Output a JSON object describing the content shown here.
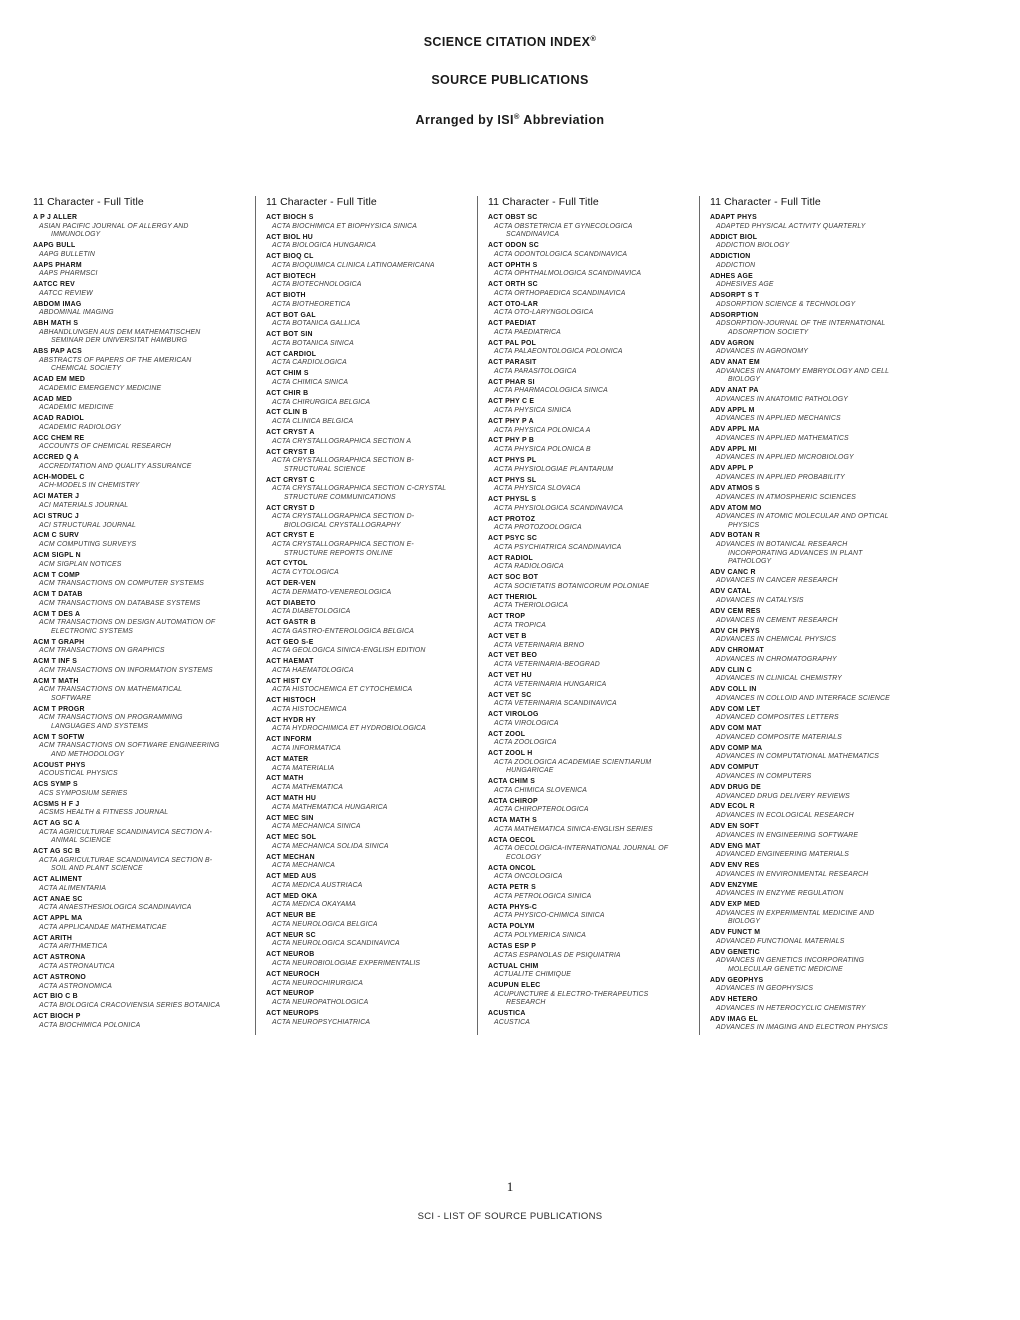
{
  "document": {
    "title_line_1": "SCIENCE CITATION INDEX",
    "title_line_1_sup": "®",
    "title_line_2": "SOURCE PUBLICATIONS",
    "title_line_3_pre": "Arranged by ISI",
    "title_line_3_sup": "®",
    "title_line_3_post": " Abbreviation",
    "page_number": "1",
    "footer_label": "SCI - LIST OF SOURCE PUBLICATIONS",
    "column_header": "11 Character - Full Title"
  },
  "columns": [
    {
      "header": "11 Character - Full Title",
      "entries": [
        {
          "abbrev": "A P J ALLER",
          "full": "ASIAN PACIFIC JOURNAL OF ALLERGY AND",
          "full2": "IMMUNOLOGY"
        },
        {
          "abbrev": "AAPG BULL",
          "full": "AAPG BULLETIN"
        },
        {
          "abbrev": "AAPS PHARM",
          "full": "AAPS PHARMSCI"
        },
        {
          "abbrev": "AATCC REV",
          "full": "AATCC REVIEW"
        },
        {
          "abbrev": "ABDOM IMAG",
          "full": "ABDOMINAL IMAGING"
        },
        {
          "abbrev": "ABH MATH S",
          "full": "ABHANDLUNGEN AUS DEM MATHEMATISCHEN",
          "full2": "SEMINAR DER UNIVERSITAT HAMBURG"
        },
        {
          "abbrev": "ABS PAP ACS",
          "full": "ABSTRACTS OF PAPERS OF THE AMERICAN",
          "full2": "CHEMICAL SOCIETY"
        },
        {
          "abbrev": "ACAD EM MED",
          "full": "ACADEMIC EMERGENCY MEDICINE"
        },
        {
          "abbrev": "ACAD MED",
          "full": "ACADEMIC MEDICINE"
        },
        {
          "abbrev": "ACAD RADIOL",
          "full": "ACADEMIC RADIOLOGY"
        },
        {
          "abbrev": "ACC CHEM RE",
          "full": "ACCOUNTS OF CHEMICAL RESEARCH"
        },
        {
          "abbrev": "ACCRED Q A",
          "full": "ACCREDITATION AND QUALITY ASSURANCE"
        },
        {
          "abbrev": "ACH-MODEL C",
          "full": "ACH-MODELS IN CHEMISTRY"
        },
        {
          "abbrev": "ACI MATER J",
          "full": "ACI MATERIALS JOURNAL"
        },
        {
          "abbrev": "ACI STRUC J",
          "full": "ACI STRUCTURAL JOURNAL"
        },
        {
          "abbrev": "ACM C SURV",
          "full": "ACM COMPUTING SURVEYS"
        },
        {
          "abbrev": "ACM SIGPL N",
          "full": "ACM SIGPLAN NOTICES"
        },
        {
          "abbrev": "ACM T COMP",
          "full": "ACM TRANSACTIONS ON COMPUTER SYSTEMS"
        },
        {
          "abbrev": "ACM T DATAB",
          "full": "ACM TRANSACTIONS ON DATABASE SYSTEMS"
        },
        {
          "abbrev": "ACM T DES A",
          "full": "ACM TRANSACTIONS ON DESIGN AUTOMATION OF",
          "full2": "ELECTRONIC SYSTEMS"
        },
        {
          "abbrev": "ACM T GRAPH",
          "full": "ACM TRANSACTIONS ON GRAPHICS"
        },
        {
          "abbrev": "ACM T INF S",
          "full": "ACM TRANSACTIONS ON INFORMATION SYSTEMS"
        },
        {
          "abbrev": "ACM T MATH",
          "full": "ACM TRANSACTIONS ON MATHEMATICAL",
          "full2": "SOFTWARE"
        },
        {
          "abbrev": "ACM T PROGR",
          "full": "ACM TRANSACTIONS ON PROGRAMMING",
          "full2": "LANGUAGES AND SYSTEMS"
        },
        {
          "abbrev": "ACM T SOFTW",
          "full": "ACM TRANSACTIONS ON SOFTWARE ENGINEERING",
          "full2": "AND METHODOLOGY"
        },
        {
          "abbrev": "ACOUST PHYS",
          "full": "ACOUSTICAL PHYSICS"
        },
        {
          "abbrev": "ACS SYMP S",
          "full": "ACS SYMPOSIUM SERIES"
        },
        {
          "abbrev": "ACSMS H F J",
          "full": "ACSMS HEALTH & FITNESS JOURNAL"
        },
        {
          "abbrev": "ACT AG SC A",
          "full": "ACTA AGRICULTURAE SCANDINAVICA SECTION A-",
          "full2": "ANIMAL SCIENCE"
        },
        {
          "abbrev": "ACT AG SC B",
          "full": "ACTA AGRICULTURAE SCANDINAVICA SECTION B-",
          "full2": "SOIL AND PLANT SCIENCE"
        },
        {
          "abbrev": "ACT ALIMENT",
          "full": "ACTA ALIMENTARIA"
        },
        {
          "abbrev": "ACT ANAE SC",
          "full": "ACTA ANAESTHESIOLOGICA SCANDINAVICA"
        },
        {
          "abbrev": "ACT APPL MA",
          "full": "ACTA APPLICANDAE MATHEMATICAE"
        },
        {
          "abbrev": "ACT ARITH",
          "full": "ACTA ARITHMETICA"
        },
        {
          "abbrev": "ACT ASTRONA",
          "full": "ACTA ASTRONAUTICA"
        },
        {
          "abbrev": "ACT ASTRONO",
          "full": "ACTA ASTRONOMICA"
        },
        {
          "abbrev": "ACT BIO C B",
          "full": "ACTA BIOLOGICA CRACOVIENSIA SERIES BOTANICA"
        },
        {
          "abbrev": "ACT BIOCH P",
          "full": "ACTA BIOCHIMICA POLONICA"
        }
      ]
    },
    {
      "header": "11 Character - Full Title",
      "entries": [
        {
          "abbrev": "ACT BIOCH S",
          "full": "ACTA BIOCHIMICA ET BIOPHYSICA SINICA"
        },
        {
          "abbrev": "ACT BIOL HU",
          "full": "ACTA BIOLOGICA HUNGARICA"
        },
        {
          "abbrev": "ACT BIOQ CL",
          "full": "ACTA BIOQUIMICA CLINICA LATINOAMERICANA"
        },
        {
          "abbrev": "ACT BIOTECH",
          "full": "ACTA BIOTECHNOLOGICA"
        },
        {
          "abbrev": "ACT BIOTH",
          "full": "ACTA BIOTHEORETICA"
        },
        {
          "abbrev": "ACT BOT GAL",
          "full": "ACTA BOTANICA GALLICA"
        },
        {
          "abbrev": "ACT BOT SIN",
          "full": "ACTA BOTANICA SINICA"
        },
        {
          "abbrev": "ACT CARDIOL",
          "full": "ACTA CARDIOLOGICA"
        },
        {
          "abbrev": "ACT CHIM S",
          "full": "ACTA CHIMICA SINICA"
        },
        {
          "abbrev": "ACT CHIR B",
          "full": "ACTA CHIRURGICA BELGICA"
        },
        {
          "abbrev": "ACT CLIN B",
          "full": "ACTA CLINICA BELGICA"
        },
        {
          "abbrev": "ACT CRYST A",
          "full": "ACTA CRYSTALLOGRAPHICA SECTION A"
        },
        {
          "abbrev": "ACT CRYST B",
          "full": "ACTA CRYSTALLOGRAPHICA SECTION B-",
          "full2": "STRUCTURAL SCIENCE"
        },
        {
          "abbrev": "ACT CRYST C",
          "full": "ACTA CRYSTALLOGRAPHICA SECTION C-CRYSTAL",
          "full2": "STRUCTURE COMMUNICATIONS"
        },
        {
          "abbrev": "ACT CRYST D",
          "full": "ACTA CRYSTALLOGRAPHICA SECTION D-",
          "full2": "BIOLOGICAL CRYSTALLOGRAPHY"
        },
        {
          "abbrev": "ACT CRYST E",
          "full": "ACTA CRYSTALLOGRAPHICA SECTION E-",
          "full2": "STRUCTURE REPORTS ONLINE"
        },
        {
          "abbrev": "ACT CYTOL",
          "full": "ACTA CYTOLOGICA"
        },
        {
          "abbrev": "ACT DER-VEN",
          "full": "ACTA DERMATO-VENEREOLOGICA"
        },
        {
          "abbrev": "ACT DIABETO",
          "full": "ACTA DIABETOLOGICA"
        },
        {
          "abbrev": "ACT GASTR B",
          "full": "ACTA GASTRO-ENTEROLOGICA BELGICA"
        },
        {
          "abbrev": "ACT GEO S-E",
          "full": "ACTA GEOLOGICA SINICA-ENGLISH EDITION"
        },
        {
          "abbrev": "ACT HAEMAT",
          "full": "ACTA HAEMATOLOGICA"
        },
        {
          "abbrev": "ACT HIST CY",
          "full": "ACTA HISTOCHEMICA ET CYTOCHEMICA"
        },
        {
          "abbrev": "ACT HISTOCH",
          "full": "ACTA HISTOCHEMICA"
        },
        {
          "abbrev": "ACT HYDR HY",
          "full": "ACTA HYDROCHIMICA ET HYDROBIOLOGICA"
        },
        {
          "abbrev": "ACT INFORM",
          "full": "ACTA INFORMATICA"
        },
        {
          "abbrev": "ACT MATER",
          "full": "ACTA MATERIALIA"
        },
        {
          "abbrev": "ACT MATH",
          "full": "ACTA MATHEMATICA"
        },
        {
          "abbrev": "ACT MATH HU",
          "full": "ACTA MATHEMATICA HUNGARICA"
        },
        {
          "abbrev": "ACT MEC SIN",
          "full": "ACTA MECHANICA SINICA"
        },
        {
          "abbrev": "ACT MEC SOL",
          "full": "ACTA MECHANICA SOLIDA SINICA"
        },
        {
          "abbrev": "ACT MECHAN",
          "full": "ACTA MECHANICA"
        },
        {
          "abbrev": "ACT MED AUS",
          "full": "ACTA MEDICA AUSTRIACA"
        },
        {
          "abbrev": "ACT MED OKA",
          "full": "ACTA MEDICA OKAYAMA"
        },
        {
          "abbrev": "ACT NEUR BE",
          "full": "ACTA NEUROLOGICA BELGICA"
        },
        {
          "abbrev": "ACT NEUR SC",
          "full": "ACTA NEUROLOGICA SCANDINAVICA"
        },
        {
          "abbrev": "ACT NEUROB",
          "full": "ACTA NEUROBIOLOGIAE EXPERIMENTALIS"
        },
        {
          "abbrev": "ACT NEUROCH",
          "full": "ACTA NEUROCHIRURGICA"
        },
        {
          "abbrev": "ACT NEUROP",
          "full": "ACTA NEUROPATHOLOGICA"
        },
        {
          "abbrev": "ACT NEUROPS",
          "full": "ACTA NEUROPSYCHIATRICA"
        }
      ]
    },
    {
      "header": "11 Character - Full Title",
      "entries": [
        {
          "abbrev": "ACT OBST SC",
          "full": "ACTA OBSTETRICIA ET GYNECOLOGICA",
          "full2": "SCANDINAVICA"
        },
        {
          "abbrev": "ACT ODON SC",
          "full": "ACTA ODONTOLOGICA SCANDINAVICA"
        },
        {
          "abbrev": "ACT OPHTH S",
          "full": "ACTA OPHTHALMOLOGICA SCANDINAVICA"
        },
        {
          "abbrev": "ACT ORTH SC",
          "full": "ACTA ORTHOPAEDICA SCANDINAVICA"
        },
        {
          "abbrev": "ACT OTO-LAR",
          "full": "ACTA OTO-LARYNGOLOGICA"
        },
        {
          "abbrev": "ACT PAEDIAT",
          "full": "ACTA PAEDIATRICA"
        },
        {
          "abbrev": "ACT PAL POL",
          "full": "ACTA PALAEONTOLOGICA POLONICA"
        },
        {
          "abbrev": "ACT PARASIT",
          "full": "ACTA PARASITOLOGICA"
        },
        {
          "abbrev": "ACT PHAR SI",
          "full": "ACTA PHARMACOLOGICA SINICA"
        },
        {
          "abbrev": "ACT PHY C E",
          "full": "ACTA PHYSICA SINICA"
        },
        {
          "abbrev": "ACT PHY P A",
          "full": "ACTA PHYSICA POLONICA A"
        },
        {
          "abbrev": "ACT PHY P B",
          "full": "ACTA PHYSICA POLONICA B"
        },
        {
          "abbrev": "ACT PHYS PL",
          "full": "ACTA PHYSIOLOGIAE PLANTARUM"
        },
        {
          "abbrev": "ACT PHYS SL",
          "full": "ACTA PHYSICA SLOVACA"
        },
        {
          "abbrev": "ACT PHYSL S",
          "full": "ACTA PHYSIOLOGICA SCANDINAVICA"
        },
        {
          "abbrev": "ACT PROTOZ",
          "full": "ACTA PROTOZOOLOGICA"
        },
        {
          "abbrev": "ACT PSYC SC",
          "full": "ACTA PSYCHIATRICA SCANDINAVICA"
        },
        {
          "abbrev": "ACT RADIOL",
          "full": "ACTA RADIOLOGICA"
        },
        {
          "abbrev": "ACT SOC BOT",
          "full": "ACTA SOCIETATIS BOTANICORUM POLONIAE"
        },
        {
          "abbrev": "ACT THERIOL",
          "full": "ACTA THERIOLOGICA"
        },
        {
          "abbrev": "ACT TROP",
          "full": "ACTA TROPICA"
        },
        {
          "abbrev": "ACT VET B",
          "full": "ACTA VETERINARIA BRNO"
        },
        {
          "abbrev": "ACT VET BEO",
          "full": "ACTA VETERINARIA-BEOGRAD"
        },
        {
          "abbrev": "ACT VET HU",
          "full": "ACTA VETERINARIA HUNGARICA"
        },
        {
          "abbrev": "ACT VET SC",
          "full": "ACTA VETERINARIA SCANDINAVICA"
        },
        {
          "abbrev": "ACT VIROLOG",
          "full": "ACTA VIROLOGICA"
        },
        {
          "abbrev": "ACT ZOOL",
          "full": "ACTA ZOOLOGICA"
        },
        {
          "abbrev": "ACT ZOOL H",
          "full": "ACTA ZOOLOGICA ACADEMIAE SCIENTIARUM",
          "full2": "HUNGARICAE"
        },
        {
          "abbrev": "ACTA CHIM S",
          "full": "ACTA CHIMICA SLOVENICA"
        },
        {
          "abbrev": "ACTA CHIROP",
          "full": "ACTA CHIROPTEROLOGICA"
        },
        {
          "abbrev": "ACTA MATH S",
          "full": "ACTA MATHEMATICA SINICA-ENGLISH SERIES"
        },
        {
          "abbrev": "ACTA OECOL",
          "full": "ACTA OECOLOGICA-INTERNATIONAL JOURNAL OF",
          "full2": "ECOLOGY"
        },
        {
          "abbrev": "ACTA ONCOL",
          "full": "ACTA ONCOLOGICA"
        },
        {
          "abbrev": "ACTA PETR S",
          "full": "ACTA PETROLOGICA SINICA"
        },
        {
          "abbrev": "ACTA PHYS-C",
          "full": "ACTA PHYSICO-CHIMICA SINICA"
        },
        {
          "abbrev": "ACTA POLYM",
          "full": "ACTA POLYMERICA SINICA"
        },
        {
          "abbrev": "ACTAS ESP P",
          "full": "ACTAS ESPANOLAS DE PSIQUIATRIA"
        },
        {
          "abbrev": "ACTUAL CHIM",
          "full": "ACTUALITE CHIMIQUE"
        },
        {
          "abbrev": "ACUPUN ELEC",
          "full": "ACUPUNCTURE & ELECTRO-THERAPEUTICS",
          "full2": "RESEARCH"
        },
        {
          "abbrev": "ACUSTICA",
          "full": "ACUSTICA"
        }
      ]
    },
    {
      "header": "11 Character - Full Title",
      "entries": [
        {
          "abbrev": "ADAPT PHYS",
          "full": "ADAPTED PHYSICAL ACTIVITY QUARTERLY"
        },
        {
          "abbrev": "ADDICT BIOL",
          "full": "ADDICTION BIOLOGY"
        },
        {
          "abbrev": "ADDICTION",
          "full": "ADDICTION"
        },
        {
          "abbrev": "ADHES AGE",
          "full": "ADHESIVES AGE"
        },
        {
          "abbrev": "ADSORPT S T",
          "full": "ADSORPTION SCIENCE & TECHNOLOGY"
        },
        {
          "abbrev": "ADSORPTION",
          "full": "ADSORPTION-JOURNAL OF THE INTERNATIONAL",
          "full2": "ADSORPTION SOCIETY"
        },
        {
          "abbrev": "ADV AGRON",
          "full": "ADVANCES IN AGRONOMY"
        },
        {
          "abbrev": "ADV ANAT EM",
          "full": "ADVANCES IN ANATOMY EMBRYOLOGY AND CELL",
          "full2": "BIOLOGY"
        },
        {
          "abbrev": "ADV ANAT PA",
          "full": "ADVANCES IN ANATOMIC PATHOLOGY"
        },
        {
          "abbrev": "ADV APPL M",
          "full": "ADVANCES IN APPLIED MECHANICS"
        },
        {
          "abbrev": "ADV APPL MA",
          "full": "ADVANCES IN APPLIED MATHEMATICS"
        },
        {
          "abbrev": "ADV APPL MI",
          "full": "ADVANCES IN APPLIED MICROBIOLOGY"
        },
        {
          "abbrev": "ADV APPL P",
          "full": "ADVANCES IN APPLIED PROBABILITY"
        },
        {
          "abbrev": "ADV ATMOS S",
          "full": "ADVANCES IN ATMOSPHERIC SCIENCES"
        },
        {
          "abbrev": "ADV ATOM MO",
          "full": "ADVANCES IN ATOMIC MOLECULAR AND OPTICAL",
          "full2": "PHYSICS"
        },
        {
          "abbrev": "ADV BOTAN R",
          "full": "ADVANCES IN BOTANICAL RESEARCH",
          "full2": "INCORPORATING ADVANCES IN PLANT",
          "full3": "PATHOLOGY"
        },
        {
          "abbrev": "ADV CANC R",
          "full": "ADVANCES IN CANCER RESEARCH"
        },
        {
          "abbrev": "ADV CATAL",
          "full": "ADVANCES IN CATALYSIS"
        },
        {
          "abbrev": "ADV CEM RES",
          "full": "ADVANCES IN CEMENT RESEARCH"
        },
        {
          "abbrev": "ADV CH PHYS",
          "full": "ADVANCES IN CHEMICAL PHYSICS"
        },
        {
          "abbrev": "ADV CHROMAT",
          "full": "ADVANCES IN CHROMATOGRAPHY"
        },
        {
          "abbrev": "ADV CLIN C",
          "full": "ADVANCES IN CLINICAL CHEMISTRY"
        },
        {
          "abbrev": "ADV COLL IN",
          "full": "ADVANCES IN COLLOID AND INTERFACE SCIENCE"
        },
        {
          "abbrev": "ADV COM LET",
          "full": "ADVANCED COMPOSITES LETTERS"
        },
        {
          "abbrev": "ADV COM MAT",
          "full": "ADVANCED COMPOSITE MATERIALS"
        },
        {
          "abbrev": "ADV COMP MA",
          "full": "ADVANCES IN COMPUTATIONAL MATHEMATICS"
        },
        {
          "abbrev": "ADV COMPUT",
          "full": "ADVANCES IN COMPUTERS"
        },
        {
          "abbrev": "ADV DRUG DE",
          "full": "ADVANCED DRUG DELIVERY REVIEWS"
        },
        {
          "abbrev": "ADV ECOL R",
          "full": "ADVANCES IN ECOLOGICAL RESEARCH"
        },
        {
          "abbrev": "ADV EN SOFT",
          "full": "ADVANCES IN ENGINEERING SOFTWARE"
        },
        {
          "abbrev": "ADV ENG MAT",
          "full": "ADVANCED ENGINEERING MATERIALS"
        },
        {
          "abbrev": "ADV ENV RES",
          "full": "ADVANCES IN ENVIRONMENTAL RESEARCH"
        },
        {
          "abbrev": "ADV ENZYME",
          "full": "ADVANCES IN ENZYME REGULATION"
        },
        {
          "abbrev": "ADV EXP MED",
          "full": "ADVANCES IN EXPERIMENTAL MEDICINE AND",
          "full2": "BIOLOGY"
        },
        {
          "abbrev": "ADV FUNCT M",
          "full": "ADVANCED FUNCTIONAL MATERIALS"
        },
        {
          "abbrev": "ADV GENETIC",
          "full": "ADVANCES IN GENETICS INCORPORATING",
          "full2": "MOLECULAR GENETIC MEDICINE"
        },
        {
          "abbrev": "ADV GEOPHYS",
          "full": "ADVANCES IN GEOPHYSICS"
        },
        {
          "abbrev": "ADV HETERO",
          "full": "ADVANCES IN HETEROCYCLIC CHEMISTRY"
        },
        {
          "abbrev": "ADV IMAG EL",
          "full": "ADVANCES IN IMAGING AND ELECTRON PHYSICS"
        }
      ]
    }
  ]
}
